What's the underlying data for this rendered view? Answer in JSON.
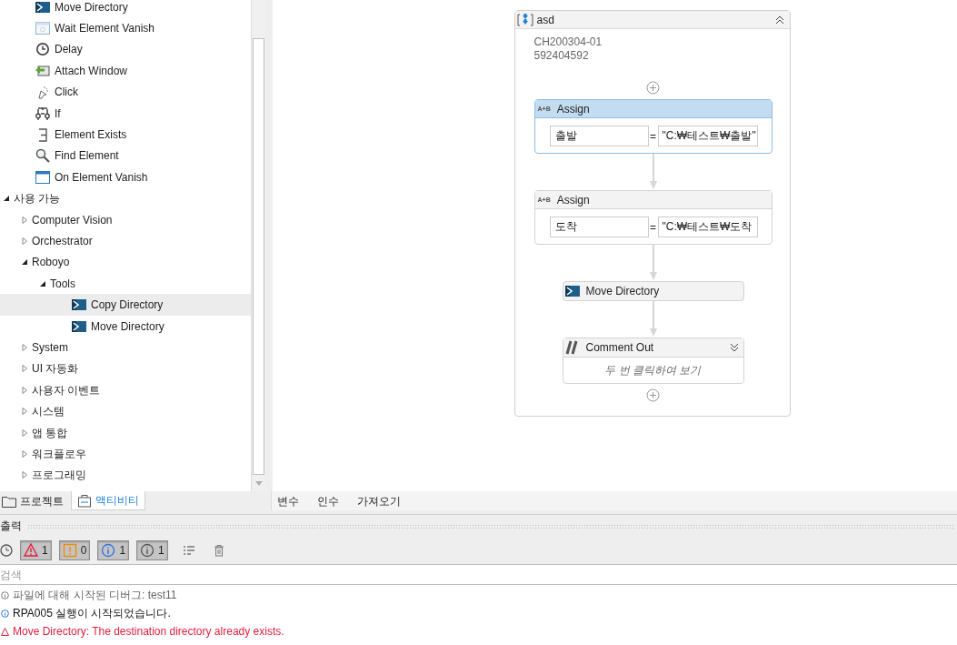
{
  "activities_tree": {
    "orphan_items": [
      {
        "label": "Move Directory",
        "kind": "directory",
        "selected": false
      },
      {
        "label": "Wait Element Vanish",
        "kind": "wait",
        "selected": false
      },
      {
        "label": "Delay",
        "kind": "delay",
        "selected": false
      },
      {
        "label": "Attach Window",
        "kind": "attach",
        "selected": false
      },
      {
        "label": "Click",
        "kind": "click",
        "selected": false
      },
      {
        "label": "If",
        "kind": "if",
        "selected": false
      },
      {
        "label": "Element Exists",
        "kind": "exists",
        "selected": false
      },
      {
        "label": "Find Element",
        "kind": "find",
        "selected": false
      },
      {
        "label": "On Element Vanish",
        "kind": "window",
        "selected": false
      }
    ],
    "items": [
      {
        "label": "사용 가능",
        "kind": "group",
        "expanded": true,
        "selected": false,
        "children": [
          {
            "label": "Computer Vision",
            "kind": "group",
            "expanded": false,
            "selected": false
          },
          {
            "label": "Orchestrator",
            "kind": "group",
            "expanded": false,
            "selected": false
          },
          {
            "label": "Roboyo",
            "kind": "group",
            "expanded": true,
            "selected": false,
            "children": [
              {
                "label": "Tools",
                "kind": "group",
                "expanded": true,
                "selected": false,
                "children": [
                  {
                    "label": "Copy Directory",
                    "kind": "directory",
                    "selected": true
                  },
                  {
                    "label": "Move Directory",
                    "kind": "directory",
                    "selected": false
                  }
                ]
              }
            ]
          },
          {
            "label": "System",
            "kind": "group",
            "expanded": false,
            "selected": false
          },
          {
            "label": "UI 자동화",
            "kind": "group",
            "expanded": false,
            "selected": false
          },
          {
            "label": "사용자 이벤트",
            "kind": "group",
            "expanded": false,
            "selected": false
          },
          {
            "label": "시스템",
            "kind": "group",
            "expanded": false,
            "selected": false
          },
          {
            "label": "앱 통합",
            "kind": "group",
            "expanded": false,
            "selected": false
          },
          {
            "label": "워크플로우",
            "kind": "group",
            "expanded": false,
            "selected": false
          },
          {
            "label": "프로그래밍",
            "kind": "group",
            "expanded": false,
            "selected": false
          }
        ]
      }
    ]
  },
  "panel_tabs": [
    {
      "label": "프로젝트",
      "kind": "folder",
      "selected": false
    },
    {
      "label": "액티비티",
      "kind": "activities",
      "selected": true
    }
  ],
  "sequence": {
    "title": "asd",
    "annotation": [
      "CH200304-01",
      "592404592"
    ],
    "activities": [
      {
        "kind": "assign",
        "badge": "A+B",
        "title": "Assign",
        "selected": true,
        "to": "출발",
        "operator": "=",
        "value": "\"C:₩테스트₩출발\""
      },
      {
        "kind": "assign",
        "badge": "A+B",
        "title": "Assign",
        "selected": false,
        "to": "도착",
        "operator": "=",
        "value": "\"C:₩테스트₩도착"
      },
      {
        "kind": "activity",
        "title": "Move Directory"
      },
      {
        "kind": "comment",
        "title": "Comment Out",
        "hint": "두 번 클릭하여 보기"
      }
    ]
  },
  "designer_tabs": [
    "변수",
    "인수",
    "가져오기"
  ],
  "output": {
    "title": "출력",
    "filters": [
      {
        "kind": "error",
        "count": "1",
        "selected": true
      },
      {
        "kind": "warning",
        "count": "0",
        "selected": true
      },
      {
        "kind": "info",
        "count": "1",
        "selected": true
      },
      {
        "kind": "trace",
        "count": "1",
        "selected": true
      }
    ],
    "search_placeholder": "검색",
    "log": [
      {
        "kind": "trace",
        "text": "파일에 대해 시작된 디버그: test11"
      },
      {
        "kind": "info",
        "text": "RPA005 실행이 시작되었습니다."
      },
      {
        "kind": "error",
        "text": "Move Directory: The destination directory already exists."
      }
    ]
  }
}
